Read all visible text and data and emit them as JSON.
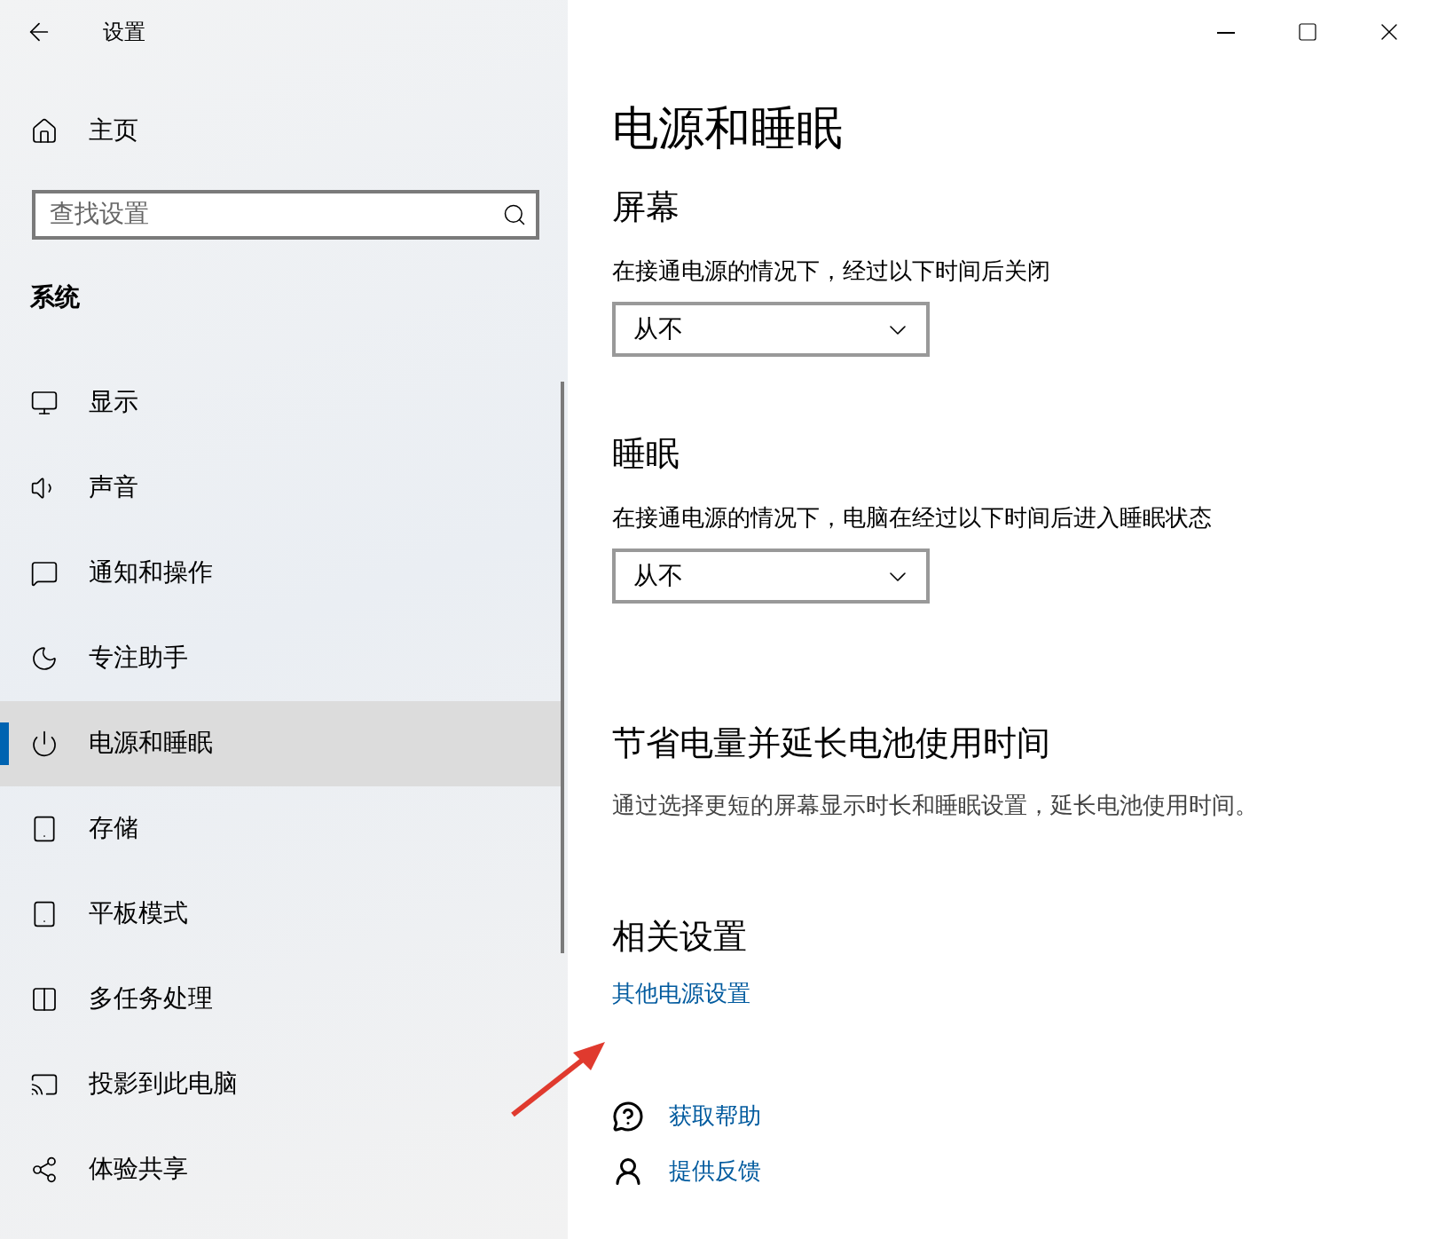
{
  "window": {
    "title": "设置"
  },
  "sidebar": {
    "home": "主页",
    "search": {
      "placeholder": "查找设置"
    },
    "section": "系统",
    "items": [
      {
        "label": "显示",
        "selected": false
      },
      {
        "label": "声音",
        "selected": false
      },
      {
        "label": "通知和操作",
        "selected": false
      },
      {
        "label": "专注助手",
        "selected": false
      },
      {
        "label": "电源和睡眠",
        "selected": true
      },
      {
        "label": "存储",
        "selected": false
      },
      {
        "label": "平板模式",
        "selected": false
      },
      {
        "label": "多任务处理",
        "selected": false
      },
      {
        "label": "投影到此电脑",
        "selected": false
      },
      {
        "label": "体验共享",
        "selected": false
      }
    ]
  },
  "content": {
    "title": "电源和睡眠",
    "sections": [
      {
        "heading": "屏幕",
        "label": "在接通电源的情况下，经过以下时间后关闭",
        "value": "从不"
      },
      {
        "heading": "睡眠",
        "label": "在接通电源的情况下，电脑在经过以下时间后进入睡眠状态",
        "value": "从不"
      }
    ],
    "battery": {
      "heading": "节省电量并延长电池使用时间",
      "text": "通过选择更短的屏幕显示时长和睡眠设置，延长电池使用时间。"
    },
    "related": {
      "heading": "相关设置",
      "link": "其他电源设置"
    },
    "help": [
      {
        "label": "获取帮助"
      },
      {
        "label": "提供反馈"
      }
    ]
  }
}
